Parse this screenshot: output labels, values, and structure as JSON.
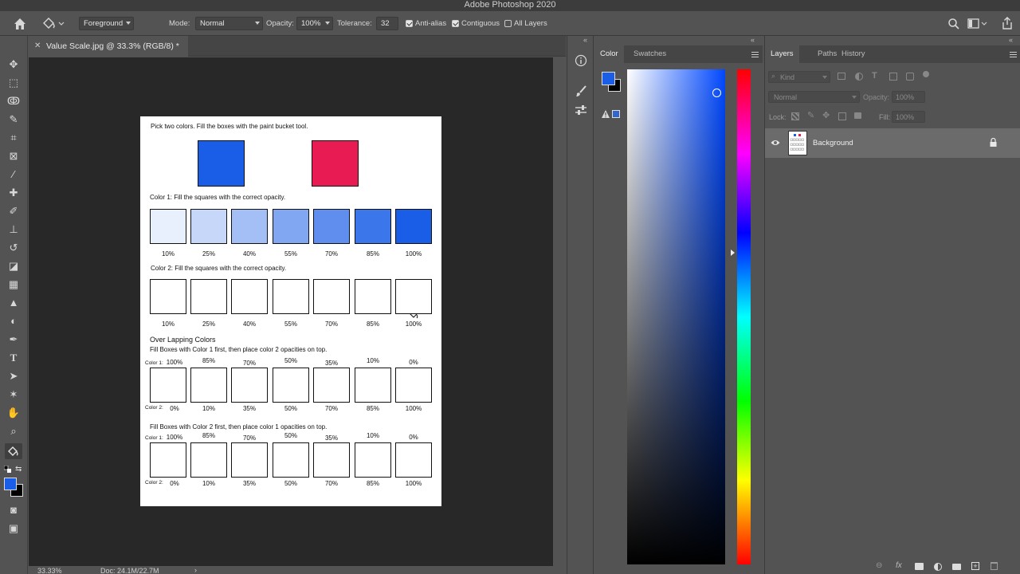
{
  "app": {
    "title": "Adobe Photoshop 2020"
  },
  "options_bar": {
    "fill_source": "Foreground",
    "mode_label": "Mode:",
    "mode_value": "Normal",
    "opacity_label": "Opacity:",
    "opacity_value": "100%",
    "tolerance_label": "Tolerance:",
    "tolerance_value": "32",
    "antialias_label": "Anti-alias",
    "antialias_checked": true,
    "contiguous_label": "Contiguous",
    "contiguous_checked": true,
    "all_layers_label": "All Layers",
    "all_layers_checked": false
  },
  "document": {
    "tab_title": "Value Scale.jpg @ 33.3% (RGB/8) *",
    "zoom": "33.33%",
    "doc_size": "Doc: 24.1M/22.7M"
  },
  "worksheet": {
    "instruction": "Pick two colors. Fill the boxes with the paint bucket tool.",
    "color1_hex": "#1a5ee8",
    "color2_hex": "#e81c52",
    "section1_title": "Color 1: Fill the squares with the correct opacity.",
    "section1_labels": [
      "10%",
      "25%",
      "40%",
      "55%",
      "70%",
      "85%",
      "100%"
    ],
    "section1_fills": [
      0.1,
      0.25,
      0.4,
      0.55,
      0.7,
      0.85,
      1.0
    ],
    "section2_title": "Color 2: Fill the squares with the correct opacity.",
    "section2_labels": [
      "10%",
      "25%",
      "40%",
      "55%",
      "70%",
      "85%",
      "100%"
    ],
    "overlap_heading": "Over Lapping Colors",
    "overlap_a_title": "Fill Boxes with Color 1 first, then place color 2 opacities on top.",
    "overlap_b_title": "Fill Boxes with Color 2 first, then place color 1 opacities on top.",
    "row_label_color1": "Color 1:",
    "row_label_color2": "Color 2:",
    "overlap_top_labels": [
      "100%",
      "85%",
      "70%",
      "50%",
      "35%",
      "10%",
      "0%"
    ],
    "overlap_bottom_labels": [
      "0%",
      "10%",
      "35%",
      "50%",
      "70%",
      "85%",
      "100%"
    ]
  },
  "color_panel": {
    "tabs": [
      "Color",
      "Swatches"
    ],
    "active_tab": "Color",
    "foreground_hex": "#1a5ee8",
    "background_hex": "#000000",
    "hue_slider_hex": "#0048ff"
  },
  "layers_panel": {
    "tabs": [
      "Layers",
      "Paths",
      "History"
    ],
    "active_tab": "Layers",
    "filter_placeholder": "Kind",
    "blend_mode": "Normal",
    "opacity_label": "Opacity:",
    "opacity_value": "100%",
    "lock_label": "Lock:",
    "fill_label": "Fill:",
    "fill_value": "100%",
    "layers": [
      {
        "name": "Background",
        "visible": true,
        "locked": true
      }
    ]
  }
}
